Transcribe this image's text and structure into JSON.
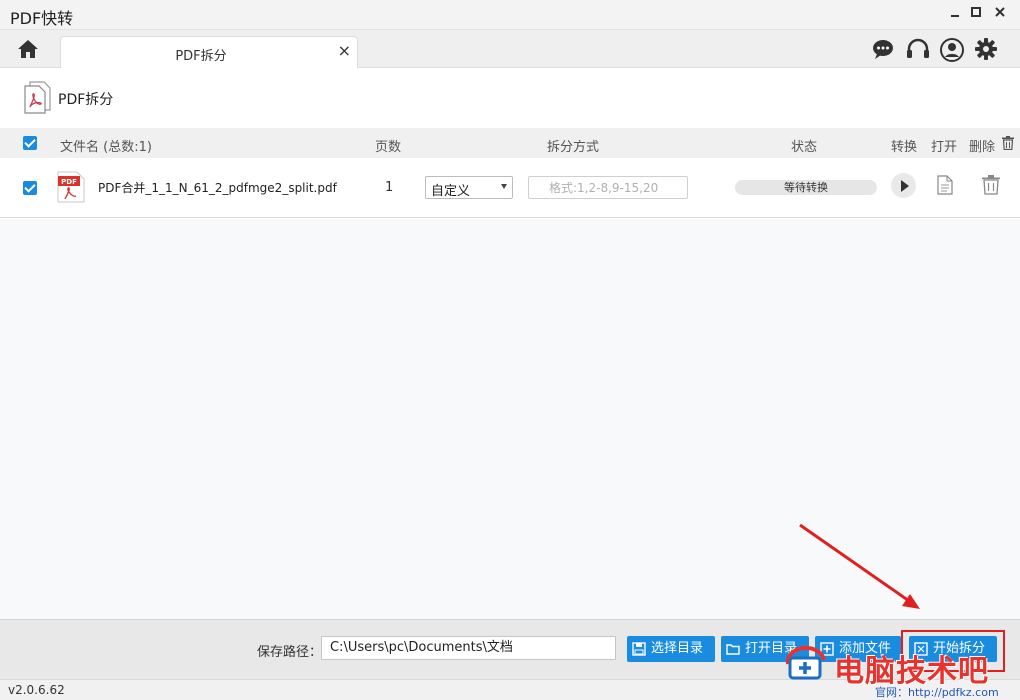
{
  "window": {
    "title": "PDF快转"
  },
  "tab": {
    "label": "PDF拆分",
    "close": "×"
  },
  "header": {
    "title": "PDF拆分"
  },
  "columns": {
    "filename": "文件名 (总数:1)",
    "pages": "页数",
    "method": "拆分方式",
    "status": "状态",
    "convert": "转换",
    "open": "打开",
    "delete": "删除"
  },
  "file_row": {
    "name": "PDF合并_1_1_N_61_2_pdfmge2_split.pdf",
    "pages": "1",
    "method": "自定义",
    "format_placeholder": "格式:1,2-8,9-15,20",
    "status": "等待转换"
  },
  "bottom": {
    "path_label": "保存路径：",
    "path_value": "C:\\Users\\pc\\Documents\\文档",
    "btn_select_dir": "选择目录",
    "btn_open_dir": "打开目录",
    "btn_add_file": "添加文件",
    "btn_start": "开始拆分"
  },
  "statusbar": {
    "version": "v2.0.6.62",
    "site": "官网：http://pdfkz.com"
  },
  "watermark": {
    "text": "电脑技术吧"
  },
  "colors": {
    "accent": "#1a8ce0",
    "highlight": "#e02020",
    "pdf_red": "#d9322b"
  }
}
